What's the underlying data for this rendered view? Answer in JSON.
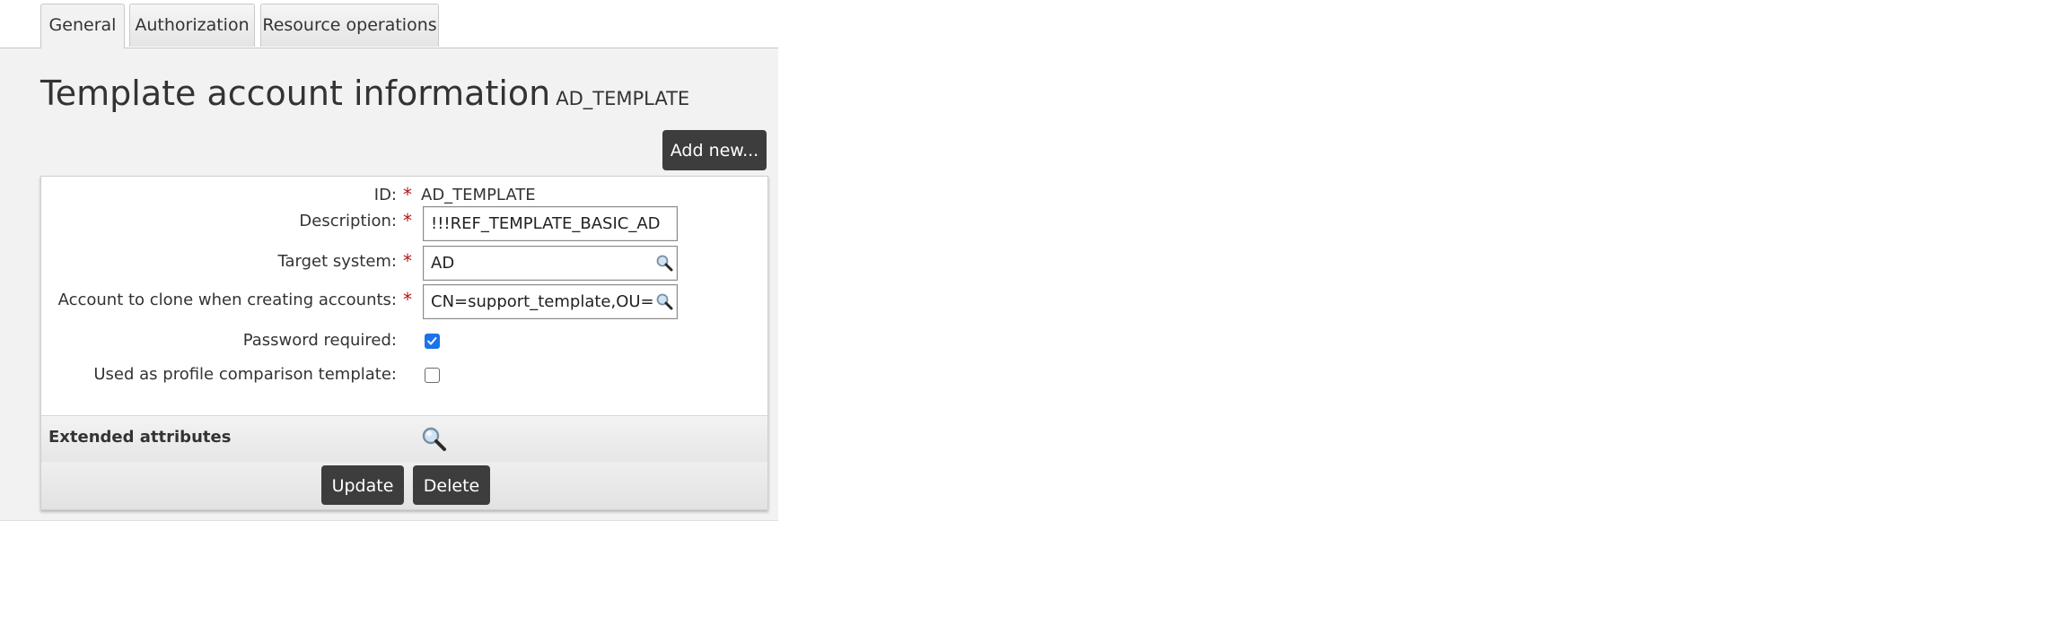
{
  "tabs": [
    {
      "label": "General",
      "active": true
    },
    {
      "label": "Authorization",
      "active": false
    },
    {
      "label": "Resource operations",
      "active": false
    }
  ],
  "page": {
    "title": "Template account information",
    "subtitle": "AD_TEMPLATE",
    "add_new_label": "Add new..."
  },
  "form": {
    "id": {
      "label": "ID:",
      "value": "AD_TEMPLATE"
    },
    "description": {
      "label": "Description:",
      "value": "!!!REF_TEMPLATE_BASIC_AD"
    },
    "target_system": {
      "label": "Target system:",
      "value": "AD"
    },
    "account_to_clone": {
      "label": "Account to clone when creating accounts:",
      "value": "CN=support_template,OU=Er"
    },
    "password_required": {
      "label": "Password required:",
      "checked": true
    },
    "profile_comparison": {
      "label": "Used as profile comparison template:",
      "checked": false
    },
    "required_marker": "*"
  },
  "extended": {
    "label": "Extended attributes"
  },
  "actions": {
    "update_label": "Update",
    "delete_label": "Delete"
  },
  "icons": {
    "lookup": "magnifier-icon",
    "checked_color": "#1a73e8",
    "required_color": "#b01818",
    "button_bg": "#3d3d3d"
  }
}
